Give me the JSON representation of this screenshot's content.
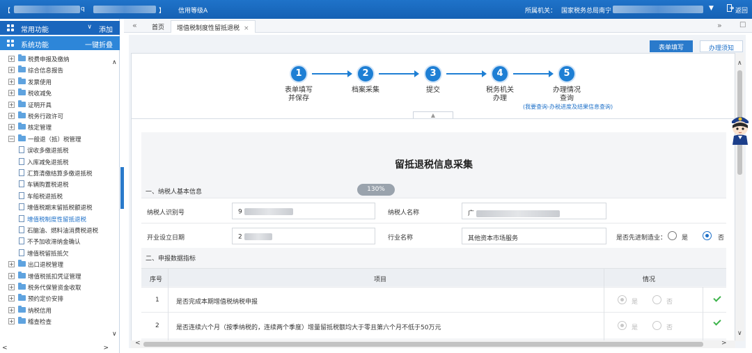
{
  "topbar": {
    "bracket_open": "【",
    "suffix_q": "q",
    "bracket_close": "】",
    "credit_level": "信用等级A",
    "authority_label": "所属机关：",
    "authority_value": "国家税务总局南宁",
    "return_label": "返回"
  },
  "sidebar": {
    "common_label": "常用功能",
    "common_action": "添加",
    "system_label": "系统功能",
    "system_action": "一键折叠",
    "items": [
      {
        "label": "税费申报及缴纳",
        "type": "folder",
        "expanded": false
      },
      {
        "label": "综合信息报告",
        "type": "folder",
        "expanded": false
      },
      {
        "label": "发票使用",
        "type": "folder",
        "expanded": false
      },
      {
        "label": "税收减免",
        "type": "folder",
        "expanded": false
      },
      {
        "label": "证明开具",
        "type": "folder",
        "expanded": false
      },
      {
        "label": "税务行政许可",
        "type": "folder",
        "expanded": false
      },
      {
        "label": "核定管理",
        "type": "folder",
        "expanded": false
      },
      {
        "label": "一般退（抵）税管理",
        "type": "folder",
        "expanded": true
      },
      {
        "label": "误收多缴退抵税",
        "type": "doc"
      },
      {
        "label": "入库减免退抵税",
        "type": "doc"
      },
      {
        "label": "汇算清缴结算多缴退抵税",
        "type": "doc"
      },
      {
        "label": "车辆购置税退税",
        "type": "doc"
      },
      {
        "label": "车船税退抵税",
        "type": "doc"
      },
      {
        "label": "增值税期末留抵税额退税",
        "type": "doc"
      },
      {
        "label": "增值税制度性留抵退税",
        "type": "doc",
        "selected": true
      },
      {
        "label": "石脑油、燃料油消费税退税",
        "type": "doc"
      },
      {
        "label": "不予加收滞纳金确认",
        "type": "doc"
      },
      {
        "label": "增值税留抵抵欠",
        "type": "doc"
      },
      {
        "label": "出口退税管理",
        "type": "folder",
        "expanded": false
      },
      {
        "label": "增值税抵扣凭证管理",
        "type": "folder",
        "expanded": false
      },
      {
        "label": "税务代保管资金收取",
        "type": "folder",
        "expanded": false
      },
      {
        "label": "预约定价安排",
        "type": "folder",
        "expanded": false
      },
      {
        "label": "纳税信用",
        "type": "folder",
        "expanded": false
      },
      {
        "label": "稽查检查",
        "type": "folder",
        "expanded": false
      }
    ]
  },
  "tabs": {
    "home": "首页",
    "active": "增值税制度性留抵退税",
    "close_glyph": "×"
  },
  "subtabs": {
    "form_fill": "表单填写",
    "notice": "办理须知"
  },
  "steps": [
    {
      "num": "1",
      "line1": "表单填写",
      "line2": "并保存"
    },
    {
      "num": "2",
      "line1": "档案采集",
      "line2": ""
    },
    {
      "num": "3",
      "line1": "提交",
      "line2": ""
    },
    {
      "num": "4",
      "line1": "税务机关",
      "line2": "办理"
    },
    {
      "num": "5",
      "line1": "办理情况",
      "line2": "查询"
    }
  ],
  "step_link": "(我要查询-办税进度及结果信息查询)",
  "form": {
    "title": "留抵退税信息采集",
    "section1": "一、纳税人基本信息",
    "zoom": "130%",
    "taxpayer_id_label": "纳税人识别号",
    "taxpayer_id_value": "9",
    "taxpayer_name_label": "纳税人名称",
    "taxpayer_name_value": "广",
    "est_date_label": "开业设立日期",
    "est_date_value": "2",
    "industry_label": "行业名称",
    "industry_value": "其他资本市场服务",
    "advanced_mfg_label": "是否先进制造业：",
    "yes": "是",
    "no": "否",
    "section2": "二、申报数据指标",
    "table_headers": {
      "seq": "序号",
      "item": "项目",
      "status": "情况"
    },
    "rows": [
      {
        "seq": "1",
        "item": "是否完成本期增值税纳税申报",
        "yes": "是",
        "no": "否"
      },
      {
        "seq": "2",
        "item": "是否连续六个月（按季纳税的，连续两个季度）增量留抵税额均大于零且第六个月不低于50万元",
        "yes": "是",
        "no": "否"
      }
    ]
  },
  "colors": {
    "brand_blue": "#1f73c9",
    "step_blue": "#1e7fd4",
    "check_green": "#3cb34a"
  }
}
